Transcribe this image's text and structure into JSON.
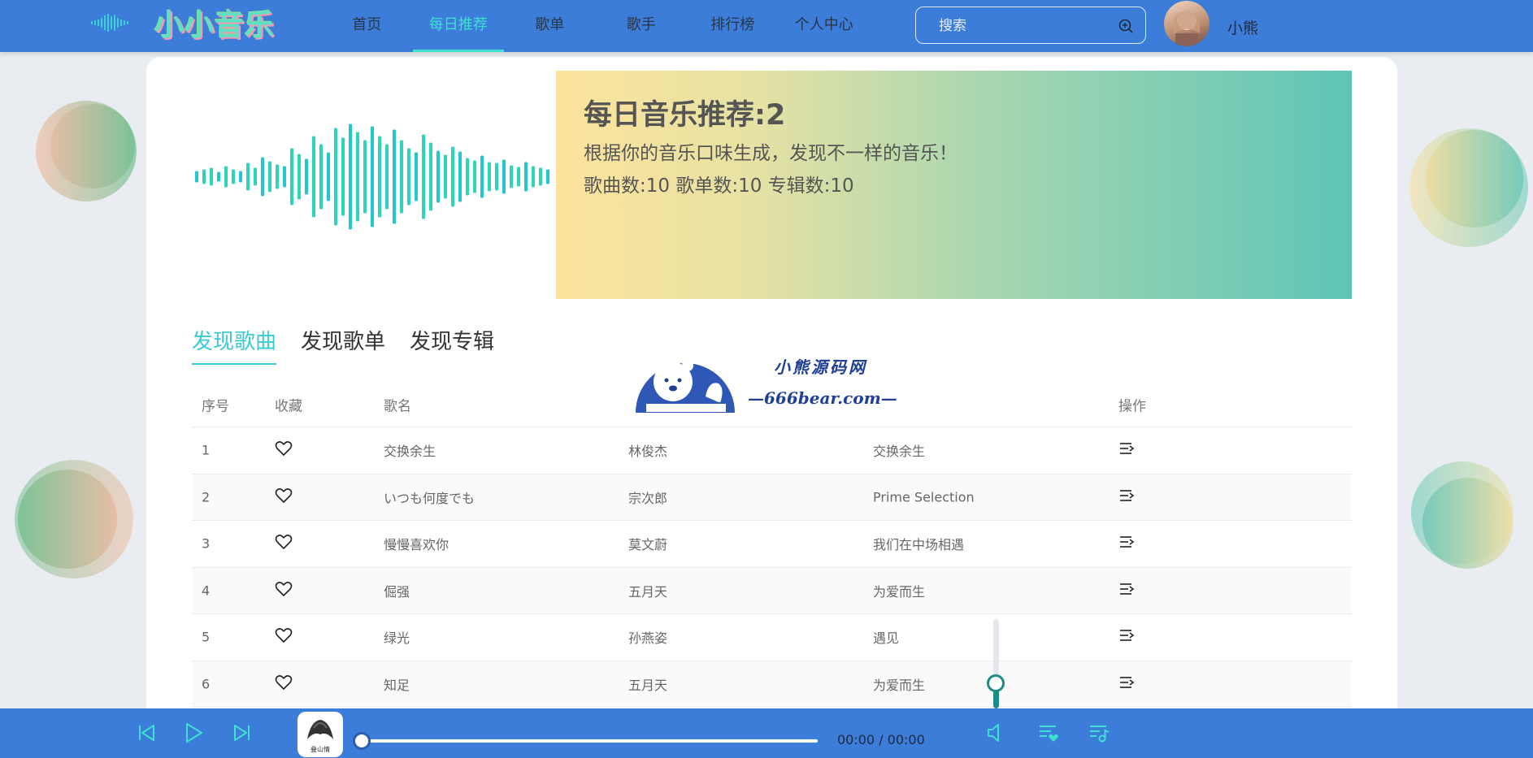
{
  "app": {
    "logo_text": "小小音乐"
  },
  "nav": {
    "items": [
      {
        "label": "首页"
      },
      {
        "label": "每日推荐"
      },
      {
        "label": "歌单"
      },
      {
        "label": "歌手"
      },
      {
        "label": "排行榜"
      },
      {
        "label": "个人中心"
      }
    ],
    "active": "每日推荐"
  },
  "search": {
    "placeholder": "搜索",
    "value": ""
  },
  "user": {
    "name": "小熊"
  },
  "banner": {
    "title": "每日音乐推荐:2",
    "description": "根据你的音乐口味生成，发现不一样的音乐！",
    "stats": "歌曲数:10 歌单数:10 专辑数:10"
  },
  "tabs": [
    {
      "label": "发现歌曲"
    },
    {
      "label": "发现歌单"
    },
    {
      "label": "发现专辑"
    }
  ],
  "tabs_active": "发现歌曲",
  "table": {
    "headers": {
      "index": "序号",
      "favorite": "收藏",
      "name": "歌名",
      "artist": "",
      "album": "",
      "operation": "操作"
    },
    "rows": [
      {
        "index": "1",
        "name": "交换余生",
        "artist": "林俊杰",
        "album": "交换余生"
      },
      {
        "index": "2",
        "name": "いつも何度でも",
        "artist": "宗次郎",
        "album": "Prime Selection"
      },
      {
        "index": "3",
        "name": "慢慢喜欢你",
        "artist": "莫文蔚",
        "album": "我们在中场相遇"
      },
      {
        "index": "4",
        "name": "倔强",
        "artist": "五月天",
        "album": "为爱而生"
      },
      {
        "index": "5",
        "name": "绿光",
        "artist": "孙燕姿",
        "album": "遇见"
      },
      {
        "index": "6",
        "name": "知足",
        "artist": "五月天",
        "album": "为爱而生"
      }
    ]
  },
  "watermark": {
    "cn": "小熊源码网",
    "en": "—666bear.com—"
  },
  "player": {
    "cover_caption": "叠山情",
    "time": "00:00 / 00:00",
    "progress": 0,
    "volume": 0.25
  },
  "colors": {
    "header": "#3b7dd8",
    "accent": "#3fe0d0",
    "tab_active": "#3ccbd4",
    "volume": "#1e8a86"
  },
  "icons": {
    "prev": "skip-previous-icon",
    "play": "play-icon",
    "next": "skip-next-icon",
    "volume": "volume-icon",
    "favorites_list": "favorites-list-icon",
    "playlist": "playlist-icon",
    "search": "search-icon",
    "heart": "heart-icon",
    "add_to_queue": "add-to-queue-icon"
  }
}
